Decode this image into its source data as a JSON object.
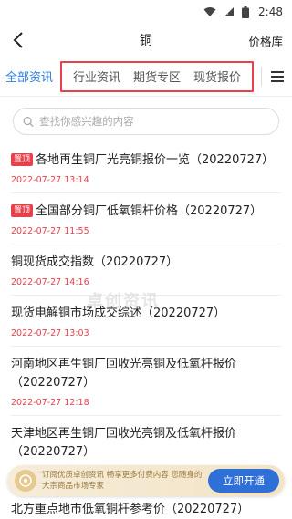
{
  "status_bar": {
    "time": "2:48"
  },
  "nav": {
    "title": "铜",
    "right_link": "价格库"
  },
  "tabs": {
    "all": "全部资讯",
    "group": [
      "行业资讯",
      "期货专区",
      "现货报价"
    ]
  },
  "search": {
    "placeholder": "查找你感兴趣的内容"
  },
  "articles": [
    {
      "badge": "置顶",
      "title": "各地再生铜厂光亮铜报价一览（20220727）",
      "date": "2022-07-27 13:14"
    },
    {
      "badge": "置顶",
      "title": "全国部分铜厂低氧铜杆价格（20220727）",
      "date": "2022-07-27 11:55"
    },
    {
      "badge": "",
      "title": "铜现货成交指数（20220727）",
      "date": "2022-07-27 14:16"
    },
    {
      "badge": "",
      "title": "现货电解铜市场成交综述（20220727）",
      "date": "2022-07-27 13:03"
    },
    {
      "badge": "",
      "title": "河南地区再生铜厂回收光亮铜及低氧杆报价（20220727）",
      "date": "2022-07-27 12:18"
    },
    {
      "badge": "",
      "title": "天津地区再生铜厂回收光亮铜及低氧杆报价（20220727）",
      "date": ""
    }
  ],
  "last_item": {
    "title": "北方重点地市低氧铜杆参考价（20220727）"
  },
  "watermark": "卓创资讯",
  "promo": {
    "text": "订阅优质卓创资讯 畅享更多付费内容 您随身的大宗商品市场专家",
    "button": "立即开通"
  },
  "colors": {
    "accent": "#2a7fe0",
    "highlight": "#e8414b",
    "promo_button": "#2f6fd8"
  }
}
